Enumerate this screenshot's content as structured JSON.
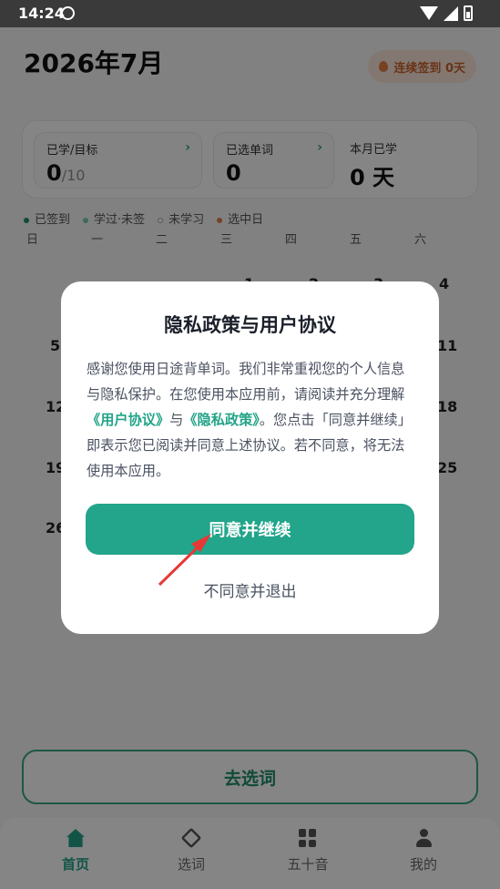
{
  "status_bar": {
    "time": "14:24"
  },
  "header": {
    "month_title": "2026年7月",
    "streak_label": "连续签到 0天"
  },
  "stats": {
    "learned": {
      "label": "已学/目标",
      "value": "0",
      "target": "/10"
    },
    "selected": {
      "label": "已选单词",
      "value": "0"
    },
    "month": {
      "label": "本月已学",
      "value": "0 天"
    }
  },
  "legend": [
    {
      "label": "已签到",
      "color": "#1f8e6c"
    },
    {
      "label": "学过·未签",
      "color": "#7cc9b0"
    },
    {
      "label": "未学习",
      "color": "#bbbbbb"
    },
    {
      "label": "选中日",
      "color": "#e07f42"
    }
  ],
  "weekdays": [
    "日",
    "一",
    "二",
    "三",
    "四",
    "五",
    "六"
  ],
  "calendar_visible_days": [
    "1",
    "2",
    "3",
    "4",
    "5",
    "11",
    "12",
    "18",
    "19",
    "25",
    "26"
  ],
  "select_words_button": "去选词",
  "tabs": [
    {
      "label": "首页",
      "active": true,
      "icon": "home-icon"
    },
    {
      "label": "选词",
      "active": false,
      "icon": "layers-icon"
    },
    {
      "label": "五十音",
      "active": false,
      "icon": "grid-icon"
    },
    {
      "label": "我的",
      "active": false,
      "icon": "user-icon"
    }
  ],
  "dialog": {
    "title": "隐私政策与用户协议",
    "body_1": "感谢您使用日途背单词。我们非常重视您的个人信息与隐私保护。在您使用本应用前，请阅读并充分理解",
    "link_user": "《用户协议》",
    "body_and": "与",
    "link_privacy": "《隐私政策》",
    "body_2": "。您点击「同意并继续」即表示您已阅读并同意上述协议。若不同意，将无法使用本应用。",
    "agree_button": "同意并继续",
    "decline_button": "不同意并退出"
  },
  "colors": {
    "accent": "#22a58a",
    "annotation_arrow": "#e53935"
  }
}
